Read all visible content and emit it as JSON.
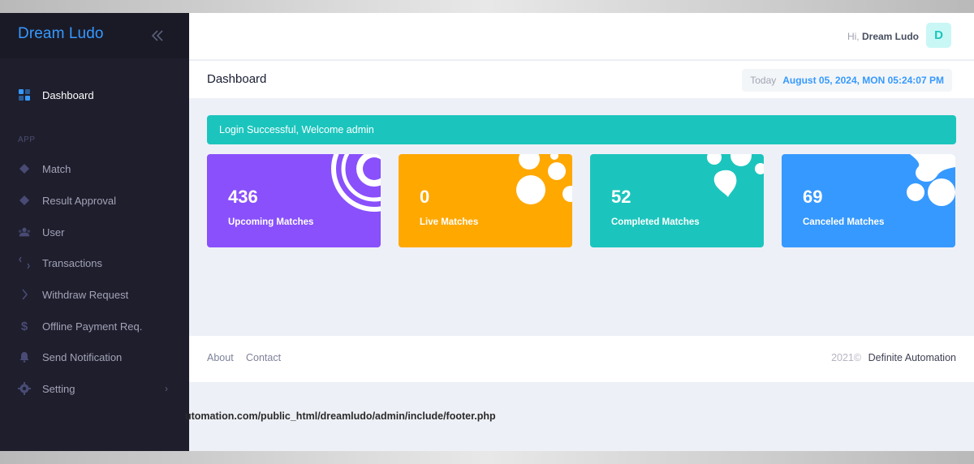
{
  "brand": "Dream Ludo",
  "sidebar": {
    "active_item": "Dashboard",
    "section_label": "APP",
    "items": [
      {
        "label": "Dashboard",
        "icon": "grid-icon"
      },
      {
        "label": "Match",
        "icon": "diamond-icon"
      },
      {
        "label": "Result Approval",
        "icon": "diamond-icon"
      },
      {
        "label": "User",
        "icon": "users-icon"
      },
      {
        "label": "Transactions",
        "icon": "transfer-icon"
      },
      {
        "label": "Withdraw Request",
        "icon": "chevron-icon"
      },
      {
        "label": "Offline Payment Req.",
        "icon": "dollar-icon"
      },
      {
        "label": "Send Notification",
        "icon": "bell-icon"
      },
      {
        "label": "Setting",
        "icon": "gear-icon"
      }
    ]
  },
  "topbar": {
    "greeting_prefix": "Hi,",
    "user_name": "Dream Ludo",
    "avatar_letter": "D"
  },
  "subheader": {
    "title": "Dashboard",
    "date_label": "Today",
    "date_value": "August 05, 2024, MON 05:24:07 PM"
  },
  "alert": "Login Successful, Welcome admin",
  "cards": [
    {
      "value": "436",
      "label": "Upcoming Matches",
      "color": "#8950fc"
    },
    {
      "value": "0",
      "label": "Live Matches",
      "color": "#ffa800"
    },
    {
      "value": "52",
      "label": "Completed Matches",
      "color": "#1bc5bd"
    },
    {
      "value": "69",
      "label": "Canceled Matches",
      "color": "#3699ff"
    }
  ],
  "footer": {
    "about": "About",
    "contact": "Contact",
    "year": "2021©",
    "company": "Definite Automation"
  },
  "path_text": "utomation.com/public_html/dreamludo/admin/include/footer.php",
  "colors": {
    "accent": "#3699ff",
    "sidebar_bg": "#1e1e2d",
    "success": "#1bc5bd"
  }
}
